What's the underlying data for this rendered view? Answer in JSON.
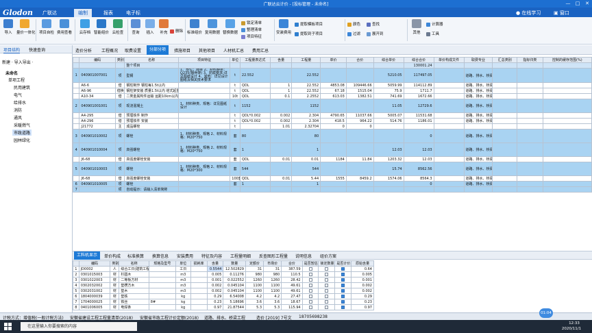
{
  "window": {
    "title": "广联达云计价 - [投标管理 - 未命名]",
    "controls": [
      "—",
      "□",
      "✕"
    ]
  },
  "menubar": {
    "logo": "Glodon",
    "logo_cn": "广联达",
    "items": [
      "编制",
      "报表",
      "电子标"
    ],
    "right": [
      "在线学习",
      "窗口"
    ]
  },
  "ribbon": {
    "buttons": [
      "导入",
      "量价一体化",
      "项目自检",
      "费用查看",
      "云存档",
      "智能组价",
      "云检查",
      "查询",
      "插入",
      "补充",
      "删除",
      "标准组价",
      "复用数据",
      "替换数据",
      "安装费用",
      "颜色",
      "展开到",
      "其他",
      "工具"
    ],
    "small": [
      "锁定清单",
      "整理清单",
      "项目特征",
      "提取模板项目",
      "提取到子项目",
      "查找",
      "过滤",
      "计算器"
    ]
  },
  "left": {
    "tabs": [
      "项目结构",
      "快速查询"
    ],
    "toolbar": "新建 · 导入导出 ·",
    "tree": [
      "未命名",
      "单项工程",
      "民用建筑",
      "电气",
      "给排水",
      "消防",
      "通风",
      "采暖燃气",
      "市政道路",
      "园林绿化"
    ]
  },
  "main_tabs": [
    "造价分析",
    "工程概况",
    "取费设置",
    "分部分项",
    "措施项目",
    "其他项目",
    "人材机汇总",
    "费用汇总"
  ],
  "grid": {
    "headers": [
      "",
      "编码",
      "类别",
      "名称",
      "项目特征",
      "单位",
      "工程量表达式",
      "含量",
      "工程量",
      "单价",
      "合价",
      "综合单价",
      "综合合价",
      "单价构成文件",
      "取费专业",
      "汇总类别",
      "指标归类",
      "控制的缓存范围(%)"
    ],
    "rows": [
      {
        "no": "",
        "code": "",
        "type": "",
        "name": "整个项目",
        "feat": "",
        "unit": "",
        "expr": "",
        "qty": "",
        "amt": "",
        "price": "",
        "total": "",
        "uprice": "",
        "utotal": "130001.24",
        "file": "",
        "prof": "",
        "style": "grp"
      },
      {
        "no": "1",
        "code": "040901007001",
        "type": "项",
        "name": "型钢",
        "feat": "1、部位：隔梁 2、材料种类：Q235(钢骨架) 3、防腐要求:详见图纸设计 4、其他：详见设计图纸及相关技术要求",
        "unit": "t",
        "expr": "22.552",
        "qty": "",
        "amt": "22.552",
        "price": "",
        "total": "",
        "uprice": "5210.05",
        "utotal": "117497.05",
        "file": "",
        "prof": "道路、排水、桥梁工程",
        "style": "blue"
      },
      {
        "no": "",
        "code": "A6-6",
        "type": "借",
        "name": "钢柱制作 钢柱每1.5t以内",
        "feat": "",
        "unit": "t",
        "expr": "QDL",
        "qty": "1",
        "amt": "22.552",
        "price": "4853.08",
        "total": "109446.66",
        "uprice": "5059.99",
        "utotal": "114112.89",
        "file": "",
        "prof": "道路、排水、桥梁工程",
        "style": ""
      },
      {
        "no": "",
        "code": "A6-96",
        "type": "借换",
        "name": "钢柱架安装 质量1.5t以内 塔式起重机换工程",
        "feat": "",
        "unit": "t",
        "expr": "QDL",
        "qty": "1",
        "amt": "22.552",
        "price": "67.18",
        "total": "1515.04",
        "uprice": "75.9",
        "utotal": "1711.7",
        "file": "",
        "prof": "道路、排水、桥梁工程",
        "style": ""
      },
      {
        "no": "",
        "code": "A10-34",
        "type": "借",
        "name": "二类金属构件运输 运距10km以内",
        "feat": "",
        "unit": "10t",
        "expr": "QDL",
        "qty": "0.1",
        "amt": "2.2552",
        "price": "613.03",
        "total": "1382.51",
        "uprice": "741.69",
        "utotal": "1672.66",
        "file": "",
        "prof": "道路、排水、桥梁工程",
        "style": ""
      },
      {
        "no": "2",
        "code": "040901001001",
        "type": "项",
        "name": "现浇混凝土",
        "feat": "1、材料种类、规格：详见图纸设计",
        "unit": "t",
        "expr": "1152",
        "qty": "",
        "amt": "1152",
        "price": "",
        "total": "",
        "uprice": "11.05",
        "utotal": "12729.6",
        "file": "",
        "prof": "道路、排水、桥梁工程",
        "style": "blue"
      },
      {
        "no": "",
        "code": "A4-295",
        "type": "借",
        "name": "预埋铁件 制作",
        "feat": "",
        "unit": "t",
        "expr": "QDL*0.002",
        "qty": "0.002",
        "amt": "2.304",
        "price": "4790.65",
        "total": "11037.66",
        "uprice": "5005.07",
        "utotal": "11531.68",
        "file": "",
        "prof": "道路、排水、桥梁工程",
        "style": ""
      },
      {
        "no": "",
        "code": "A4-296",
        "type": "借",
        "name": "预埋铁件 安装",
        "feat": "",
        "unit": "t",
        "expr": "QDL*0.002",
        "qty": "0.002",
        "amt": "2.304",
        "price": "418.5",
        "total": "964.22",
        "uprice": "514.76",
        "utotal": "1186.01",
        "file": "",
        "prof": "道路、排水、桥梁工程",
        "style": ""
      },
      {
        "no": "",
        "code": "J21772",
        "type": "主",
        "name": "成品螺栓",
        "feat": "",
        "unit": "t",
        "expr": "",
        "qty": "1.01",
        "amt": "2.32704",
        "price": "0",
        "total": "0",
        "uprice": "",
        "utotal": "",
        "file": "",
        "prof": "",
        "style": ""
      },
      {
        "no": "3",
        "code": "040901010002",
        "type": "项",
        "name": "螺栓",
        "feat": "1、材料种类、规格 2、材料规格：M20*750",
        "unit": "套",
        "expr": "80",
        "qty": "",
        "amt": "80",
        "price": "",
        "total": "",
        "uprice": "",
        "utotal": "0",
        "file": "",
        "prof": "道路、排水、桥梁工程",
        "style": "blue"
      },
      {
        "no": "4",
        "code": "040901010004",
        "type": "项",
        "name": "高强螺栓",
        "feat": "1、材料种类、规格 2、材料规格：M20*750",
        "unit": "套",
        "expr": "1",
        "qty": "",
        "amt": "1",
        "price": "",
        "total": "",
        "uprice": "12.03",
        "utotal": "12.03",
        "file": "",
        "prof": "道路、排水、桥梁工程",
        "style": "blue"
      },
      {
        "no": "",
        "code": "J6-68",
        "type": "借",
        "name": "高强度螺栓安装",
        "feat": "",
        "unit": "套",
        "expr": "QDL",
        "qty": "0.01",
        "amt": "0.01",
        "price": "1184",
        "total": "11.84",
        "uprice": "1203.32",
        "utotal": "12.03",
        "file": "",
        "prof": "道路、排水、桥梁工程",
        "style": ""
      },
      {
        "no": "5",
        "code": "040901010003",
        "type": "项",
        "name": "螺栓",
        "feat": "1、材料种类、规格 2、材料规格：M20*300",
        "unit": "套",
        "expr": "544",
        "qty": "",
        "amt": "544",
        "price": "",
        "total": "",
        "uprice": "15.74",
        "utotal": "8562.56",
        "file": "",
        "prof": "道路、排水、桥梁工程",
        "style": "blue"
      },
      {
        "no": "",
        "code": "J6-68",
        "type": "借",
        "name": "高强度螺栓安装",
        "feat": "",
        "unit": "100套",
        "expr": "QDL",
        "qty": "0.01",
        "amt": "5.44",
        "price": "1555",
        "total": "8459.2",
        "uprice": "1574.06",
        "utotal": "8564.3",
        "file": "",
        "prof": "道路、排水、桥梁工程",
        "style": ""
      },
      {
        "no": "6",
        "code": "040901010005",
        "type": "项",
        "name": "螺栓",
        "feat": "",
        "unit": "套",
        "expr": "1",
        "qty": "",
        "amt": "1",
        "price": "",
        "total": "",
        "uprice": "",
        "utotal": "0",
        "file": "",
        "prof": "道路、排水、桥梁工程",
        "style": "blue"
      },
      {
        "no": "7",
        "code": "",
        "type": "项",
        "name": "自动提示：请输入清单简称",
        "feat": "",
        "unit": "",
        "expr": "",
        "qty": "",
        "amt": "",
        "price": "",
        "total": "",
        "uprice": "",
        "utotal": "",
        "file": "",
        "prof": "",
        "style": "blue"
      }
    ]
  },
  "bottom_tabs": [
    "工料机显示",
    "单价构成",
    "标准换算",
    "换算信息",
    "安装费用",
    "特征及内容",
    "工程量明细",
    "反查图形工程量",
    "说明信息",
    "组价方案"
  ],
  "sub": {
    "headers": [
      "",
      "编码",
      "类别",
      "名称",
      "规格及型号",
      "单位",
      "损耗率",
      "含量",
      "数量",
      "定额价",
      "市场价",
      "合价",
      "是否暂估",
      "锁定数量",
      "是否计价",
      "原始含量"
    ],
    "rows": [
      {
        "no": "1",
        "code": "JD0002",
        "type": "人",
        "name": "综合工日(建筑工程)",
        "spec": "",
        "unit": "工日",
        "loss": "",
        "qty": "0.5544",
        "num": "12.502829",
        "base": "31",
        "mkt": "31",
        "sum": "387.59",
        "est": false,
        "lock": false,
        "calc": true,
        "orig": "0.64"
      },
      {
        "no": "2",
        "code": "0301015003",
        "type": "材",
        "name": "杉圆木",
        "spec": "",
        "unit": "m3",
        "loss": "",
        "qty": "0.005",
        "num": "0.11276",
        "base": "980",
        "mkt": "980",
        "sum": "110.5",
        "est": false,
        "lock": false,
        "calc": true,
        "orig": "0.005"
      },
      {
        "no": "3",
        "code": "0301022003",
        "type": "材",
        "name": "二等板方材",
        "spec": "",
        "unit": "m3",
        "loss": "",
        "qty": "0.001",
        "num": "0.022552",
        "base": "1260",
        "mkt": "1260",
        "sum": "28.42",
        "est": false,
        "lock": false,
        "calc": true,
        "orig": "0.001"
      },
      {
        "no": "4",
        "code": "0302032002",
        "type": "材",
        "name": "垫楞方木",
        "spec": "",
        "unit": "m3",
        "loss": "",
        "qty": "0.002",
        "num": "0.045104",
        "base": "1100",
        "mkt": "1100",
        "sum": "49.61",
        "est": false,
        "lock": false,
        "calc": true,
        "orig": "0.002"
      },
      {
        "no": "5",
        "code": "0302031002",
        "type": "材",
        "name": "垫木",
        "spec": "",
        "unit": "m3",
        "loss": "",
        "qty": "0.002",
        "num": "0.045104",
        "base": "1100",
        "mkt": "1100",
        "sum": "49.61",
        "est": false,
        "lock": false,
        "calc": true,
        "orig": "0.002"
      },
      {
        "no": "6",
        "code": "1804000039",
        "type": "材",
        "name": "垫铁",
        "spec": "",
        "unit": "kg",
        "loss": "",
        "qty": "0.29",
        "num": "6.54008",
        "base": "4.2",
        "mkt": "4.2",
        "sum": "27.47",
        "est": false,
        "lock": false,
        "calc": true,
        "orig": "0.29"
      },
      {
        "no": "7",
        "code": "1704000025",
        "type": "材",
        "name": "铁丝",
        "spec": "8#",
        "unit": "kg",
        "loss": "",
        "qty": "0.23",
        "num": "5.18696",
        "base": "3.6",
        "mkt": "3.6",
        "sum": "18.67",
        "est": false,
        "lock": false,
        "calc": true,
        "orig": "0.23"
      },
      {
        "no": "8",
        "code": "0401006005",
        "type": "材",
        "name": "电焊条",
        "spec": "",
        "unit": "kg",
        "loss": "",
        "qty": "0.97",
        "num": "21.87544",
        "base": "5.3",
        "mkt": "5.3",
        "sum": "115.94",
        "est": false,
        "lock": false,
        "calc": true,
        "orig": "0.97"
      }
    ]
  },
  "status": [
    "计税方式：增值税(一般计税方法)",
    "安徽省建设工程工程量清单(2018)",
    "安徽省市政工程计价定额(2018)",
    "道路、排水、桥梁工程",
    "造价 [2019] 7号文",
    "18705698238"
  ],
  "taskbar": {
    "search": "在这里输入你要搜索的内容",
    "time": "12:33",
    "date": "2020/11/1",
    "badge": "01:04"
  }
}
